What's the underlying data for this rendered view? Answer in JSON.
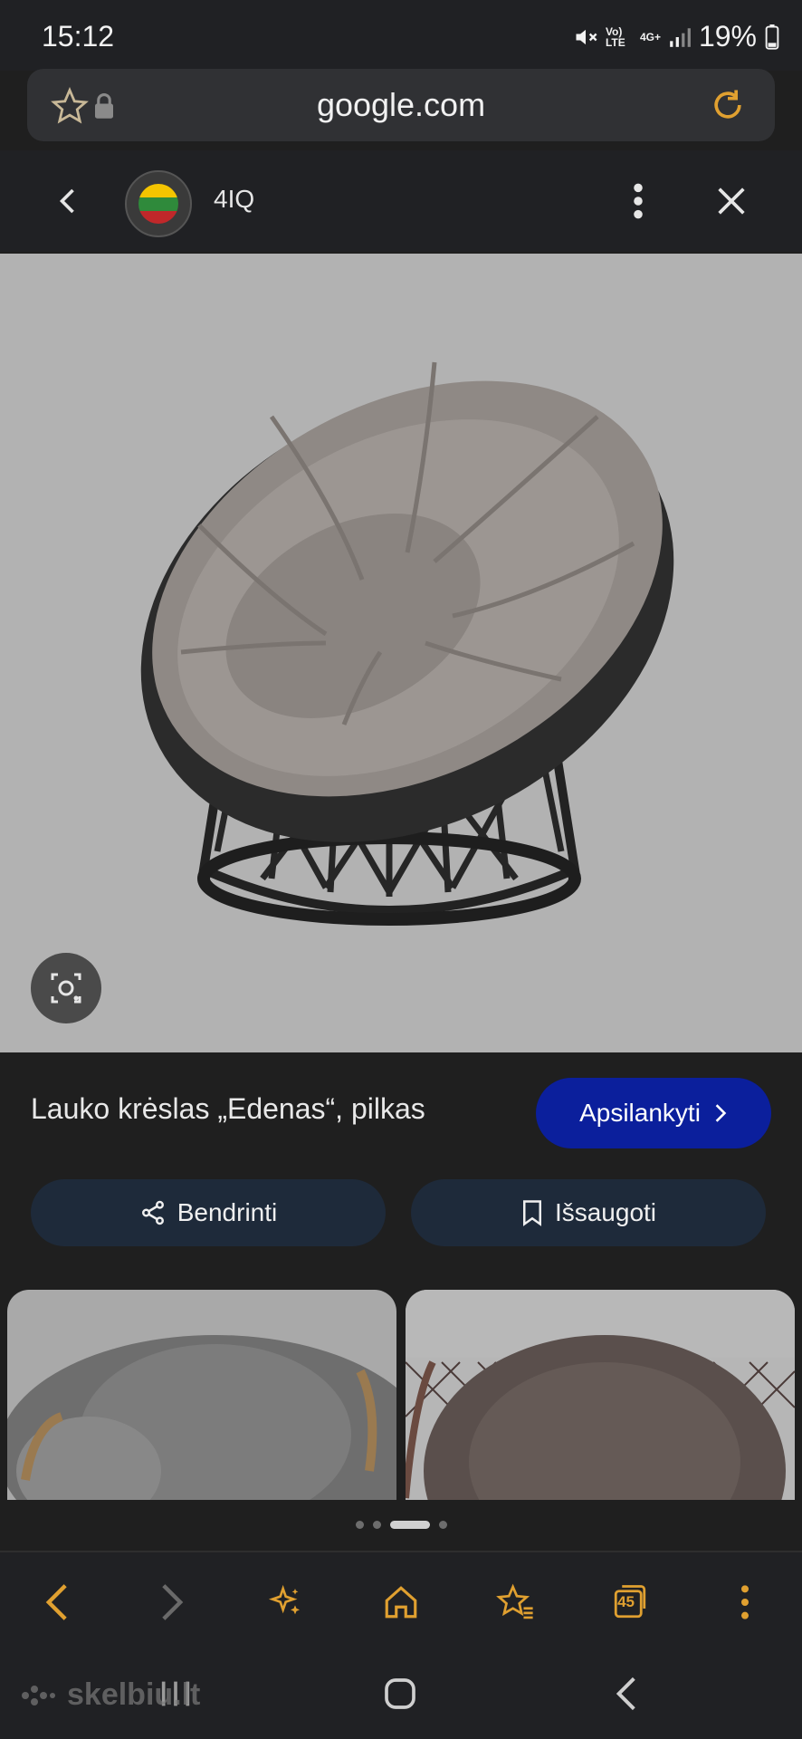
{
  "status": {
    "time": "15:12",
    "battery": "19%",
    "network": "Vo) LTE",
    "net2": "4G+"
  },
  "urlbar": {
    "url": "google.com"
  },
  "header": {
    "source": "4IQ"
  },
  "product": {
    "title": "Lauko krėslas „Edenas“, pilkas",
    "visit_label": "Apsilankyti"
  },
  "actions": {
    "share_label": "Bendrinti",
    "save_label": "Išsaugoti"
  },
  "carousel": {
    "dot_count": 4,
    "active_index": 2
  },
  "toolbar": {
    "tabs_count": "45"
  },
  "watermark": {
    "text": "skelbiu.lt"
  },
  "colors": {
    "accent": "#0b1f9c",
    "pill": "#1e2a3a",
    "background": "#1f1f1f",
    "image_bg": "#b2b2b2"
  },
  "icons": [
    "star-icon",
    "lock-icon",
    "reload-icon",
    "back-icon",
    "more-vert-icon",
    "close-icon",
    "lens-icon",
    "share-icon",
    "bookmark-icon",
    "chevron-left-icon",
    "chevron-right-icon",
    "sparkle-icon",
    "home-icon",
    "bookmarks-icon",
    "tabs-icon",
    "menu-icon",
    "recents-icon",
    "home-nav-icon",
    "back-nav-icon"
  ]
}
